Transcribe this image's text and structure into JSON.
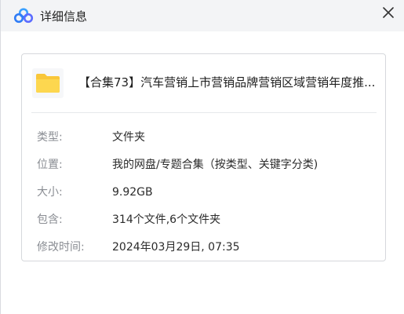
{
  "window": {
    "title": "详细信息",
    "close_icon": "close-icon",
    "app_icon": "baidu-netdisk-logo"
  },
  "file": {
    "icon": "folder-icon",
    "name": "【合集73】汽车营销上市营销品牌营销区域营销年度推..."
  },
  "properties": [
    {
      "label": "类型:",
      "value": "文件夹"
    },
    {
      "label": "位置:",
      "value": "我的网盘/专题合集（按类型、关键字分类)"
    },
    {
      "label": "大小:",
      "value": "9.92GB"
    },
    {
      "label": "包含:",
      "value": "314个文件,6个文件夹"
    },
    {
      "label": "修改时间:",
      "value": "2024年03月29日, 07:35"
    }
  ],
  "colors": {
    "titlebar_bg": "#f3f4f6",
    "folder_yellow": "#f9c73a",
    "label_gray": "#8a8d93",
    "logo_blue": "#2f7cf6"
  }
}
